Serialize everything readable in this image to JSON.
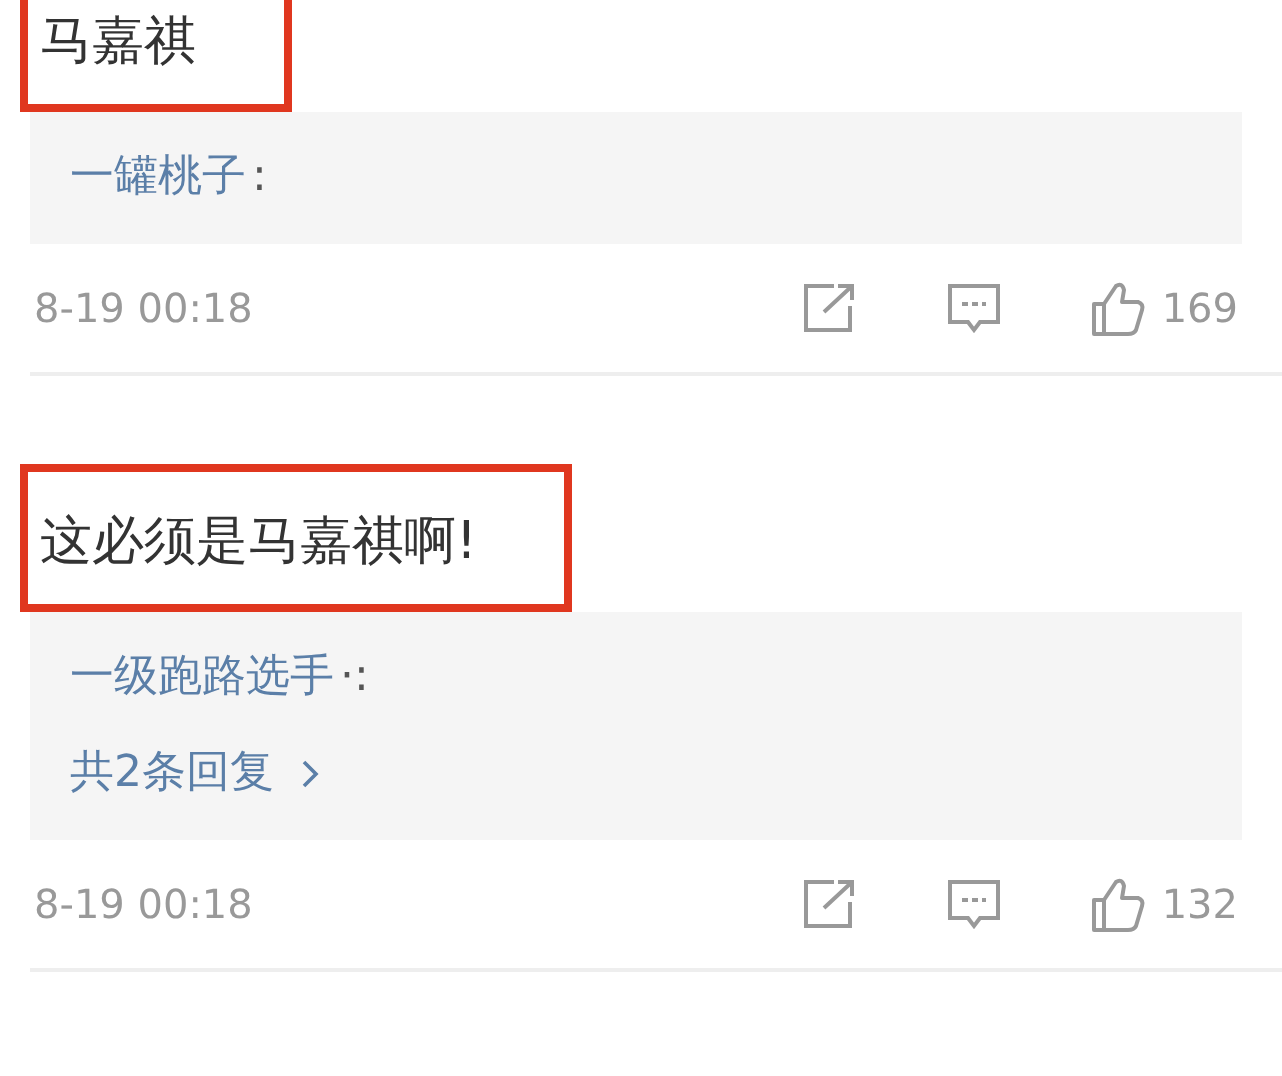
{
  "comments": [
    {
      "text": "马嘉祺",
      "highlighted": true,
      "replies": [
        {
          "author": "一罐桃子",
          "separator": ":"
        }
      ],
      "time": "8-19 00:18",
      "likes": "169"
    },
    {
      "text": "这必须是马嘉祺啊!",
      "highlighted": true,
      "replies": [
        {
          "author": "一级跑路选手",
          "separator": "·:"
        }
      ],
      "more_replies": "共2条回复",
      "time": "8-19 00:18",
      "likes": "132"
    }
  ]
}
